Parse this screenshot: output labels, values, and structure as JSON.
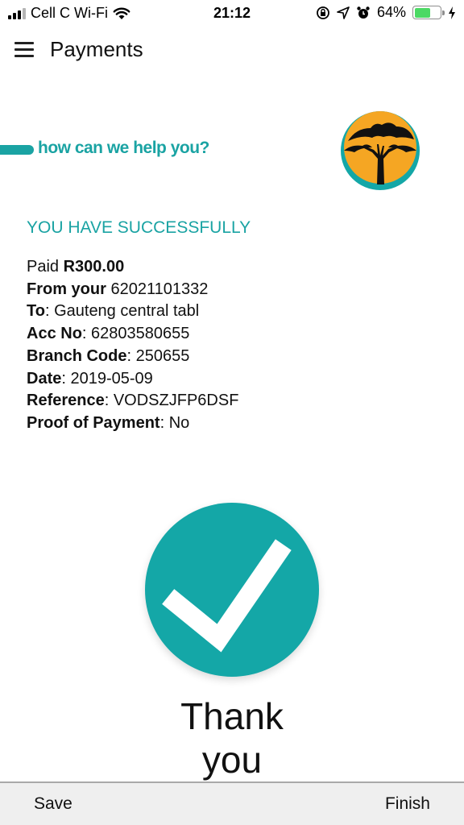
{
  "status_bar": {
    "carrier": "Cell C Wi-Fi",
    "time": "21:12",
    "battery_percent": "64%",
    "battery_level": 0.64,
    "signal_bars_active": 3,
    "icons": [
      "signal-icon",
      "wifi-icon",
      "orientation-lock-icon",
      "location-icon",
      "alarm-icon",
      "battery-icon",
      "charging-icon"
    ]
  },
  "header": {
    "title": "Payments",
    "menu_icon": "hamburger-menu-icon"
  },
  "banner": {
    "tagline": "how can we help you?",
    "logo": "tree-logo"
  },
  "confirmation": {
    "title": "YOU HAVE SUCCESSFULLY",
    "rows": [
      {
        "label": "Paid",
        "value": "R300.00"
      },
      {
        "label": "From your",
        "value": "62021101332"
      },
      {
        "label": "To",
        "value": "Gauteng central tabl"
      },
      {
        "label": "Acc No",
        "value": "62803580655"
      },
      {
        "label": "Branch Code",
        "value": "250655"
      },
      {
        "label": "Date",
        "value": "2019-05-09"
      },
      {
        "label": "Reference",
        "value": "VODSZJFP6DSF"
      },
      {
        "label": "Proof of Payment",
        "value": "No"
      }
    ],
    "check_icon": "checkmark-icon",
    "message_line1": "Thank",
    "message_line2": "you"
  },
  "footer": {
    "save_label": "Save",
    "finish_label": "Finish"
  },
  "colors": {
    "accent": "#1aa3a3",
    "check_circle": "#14a7a7",
    "logo_orange": "#f5a623",
    "battery": "#4cd964"
  }
}
